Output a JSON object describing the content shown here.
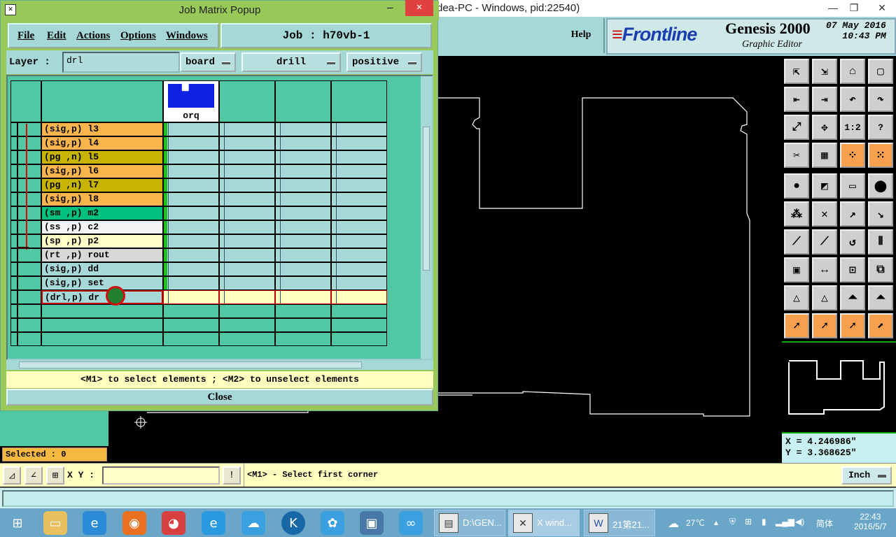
{
  "background_window": {
    "title": "dea-PC - Windows, pid:22540)",
    "help_label": "Help",
    "brand": "Frontline",
    "product": "Genesis 2000",
    "subtitle": "Graphic Editor",
    "date": "07 May 2016",
    "time": "10:43 PM"
  },
  "popup": {
    "title": "Job Matrix Popup",
    "menu": [
      "File",
      "Edit",
      "Actions",
      "Options",
      "Windows"
    ],
    "job_label": "Job : h70vb-1",
    "layer_label": "Layer :",
    "layer_value": "drl",
    "context_dropdown": "board",
    "type_dropdown": "drill",
    "polarity_dropdown": "positive",
    "step_name": "orq",
    "layers": [
      {
        "label": "(sig,p) l3",
        "color": "#f9b44c"
      },
      {
        "label": "(sig,p) l4",
        "color": "#f9b44c"
      },
      {
        "label": "(pg ,n) l5",
        "color": "#c8b400"
      },
      {
        "label": "(sig,p) l6",
        "color": "#f9b44c"
      },
      {
        "label": "(pg ,n) l7",
        "color": "#c8b400"
      },
      {
        "label": "(sig,p) l8",
        "color": "#f9b44c"
      },
      {
        "label": "(sm ,p) m2",
        "color": "#00c080"
      },
      {
        "label": "(ss ,p) c2",
        "color": "#f4f4f4"
      },
      {
        "label": "(sp ,p) p2",
        "color": "#ffffc8"
      },
      {
        "label": "(rt ,p) rout",
        "color": "#d8d8d8"
      },
      {
        "label": "(sig,p) dd",
        "color": "#a6d8d8"
      },
      {
        "label": "(sig,p) set",
        "color": "#a6d8d8"
      },
      {
        "label": "(drl,p) dr",
        "color": "#a6d8d8"
      }
    ],
    "hint": "<M1> to select elements ; <M2> to unselect elements",
    "close_label": "Close"
  },
  "status": {
    "selected": "Selected : 0",
    "xy_label": "X Y :",
    "message": "<M1> - Select first corner",
    "unit": "Inch",
    "x_readout": "X = 4.246986\"",
    "y_readout": "Y = 3.368625\""
  },
  "taskbar": {
    "tasks": [
      "D:\\GEN...",
      "X wind...",
      "21第21..."
    ],
    "temperature": "27℃",
    "ime": "简体",
    "clock_time": "22:43",
    "clock_date": "2016/5/7"
  },
  "colors": {
    "accent_teal": "#a6d8d8",
    "matrix_bg": "#50c8a4",
    "popup_frame": "#98c858",
    "status_yellow": "#ffffc0"
  },
  "tools": [
    "zoom-home",
    "zoom-out",
    "home",
    "window",
    "pan-left",
    "pan-right",
    "undo",
    "redo",
    "fit",
    "center",
    "1:2",
    "help",
    "measure",
    "grid",
    "snap-a",
    "snap-b",
    "select-feature",
    "rect-select",
    "ruler",
    "pad",
    "route",
    "cross",
    "move",
    "copy",
    "line",
    "arc",
    "rotate",
    "mirror",
    "add-pad",
    "split",
    "align",
    "group",
    "tri-a",
    "tri-b",
    "tri-c",
    "tri-d",
    "pointer",
    "pointer-sel",
    "pointer-area",
    "pointer-net"
  ]
}
